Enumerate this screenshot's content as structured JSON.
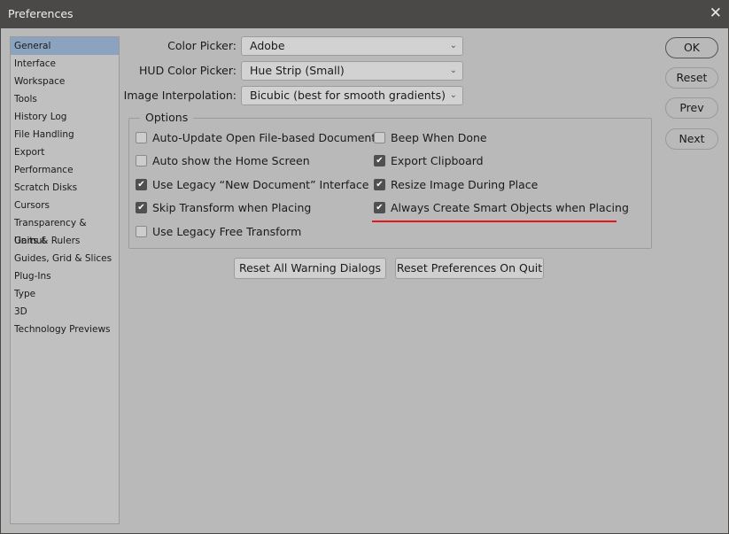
{
  "window": {
    "title": "Preferences",
    "close_icon": "close-icon"
  },
  "sidebar": {
    "selected": "General",
    "items": [
      "General",
      "Interface",
      "Workspace",
      "Tools",
      "History Log",
      "File Handling",
      "Export",
      "Performance",
      "Scratch Disks",
      "Cursors",
      "Transparency & Gamut",
      "Units & Rulers",
      "Guides, Grid & Slices",
      "Plug-Ins",
      "Type",
      "3D",
      "Technology Previews"
    ]
  },
  "fields": [
    {
      "label": "Color Picker:",
      "value": "Adobe"
    },
    {
      "label": "HUD Color Picker:",
      "value": "Hue Strip (Small)"
    },
    {
      "label": "Image Interpolation:",
      "value": "Bicubic (best for smooth gradients)"
    }
  ],
  "options": {
    "title": "Options",
    "items": [
      {
        "label": "Auto-Update Open File-based Documents",
        "checked": false
      },
      {
        "label": "Auto show the Home Screen",
        "checked": false
      },
      {
        "label": "Use Legacy “New Document” Interface",
        "checked": true
      },
      {
        "label": "Skip Transform when Placing",
        "checked": true
      },
      {
        "label": "Use Legacy Free Transform",
        "checked": false
      },
      {
        "label": "Beep When Done",
        "checked": false
      },
      {
        "label": "Export Clipboard",
        "checked": true
      },
      {
        "label": "Resize Image During Place",
        "checked": true
      },
      {
        "label": "Always Create Smart Objects when Placing",
        "checked": true
      }
    ]
  },
  "highlight_color": "#e8141c",
  "buttons": {
    "reset_warnings": "Reset All Warning Dialogs",
    "reset_on_quit": "Reset Preferences On Quit",
    "ok": "OK",
    "reset": "Reset",
    "prev": "Prev",
    "next": "Next"
  }
}
